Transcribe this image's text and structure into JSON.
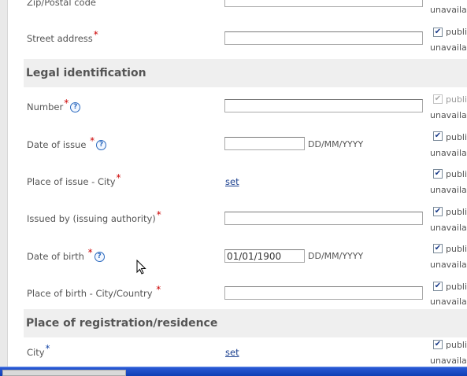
{
  "fields": {
    "zip": {
      "label": "Zip/Postal code",
      "value": "",
      "public_checked": false
    },
    "street": {
      "label": "Street address",
      "value": "",
      "public_checked": true
    },
    "number": {
      "label": "Number",
      "value": "",
      "public_checked": true,
      "public_disabled": true
    },
    "date_of_issue": {
      "label": "Date of issue",
      "value": "",
      "format": "DD/MM/YYYY",
      "public_checked": true
    },
    "place_of_issue": {
      "label": "Place of issue - City",
      "link": "set",
      "public_checked": true
    },
    "issued_by": {
      "label": "Issued by (issuing authority)",
      "value": "",
      "public_checked": true
    },
    "date_of_birth": {
      "label": "Date of birth",
      "value": "01/01/1900",
      "format": "DD/MM/YYYY",
      "public_checked": true
    },
    "place_of_birth": {
      "label": "Place of birth - City/Country",
      "value": "",
      "public_checked": true
    },
    "city": {
      "label": "City",
      "link": "set",
      "public_checked": true
    }
  },
  "sections": {
    "legal": "Legal identification",
    "registration": "Place of registration/residence"
  },
  "common": {
    "public_label": "publi",
    "unavailable_label": "unavaila",
    "required_mark": "*",
    "help_mark": "?"
  },
  "colors": {
    "required": "#cc0000",
    "link": "#1a3f8f",
    "section_bg": "#efefef"
  }
}
